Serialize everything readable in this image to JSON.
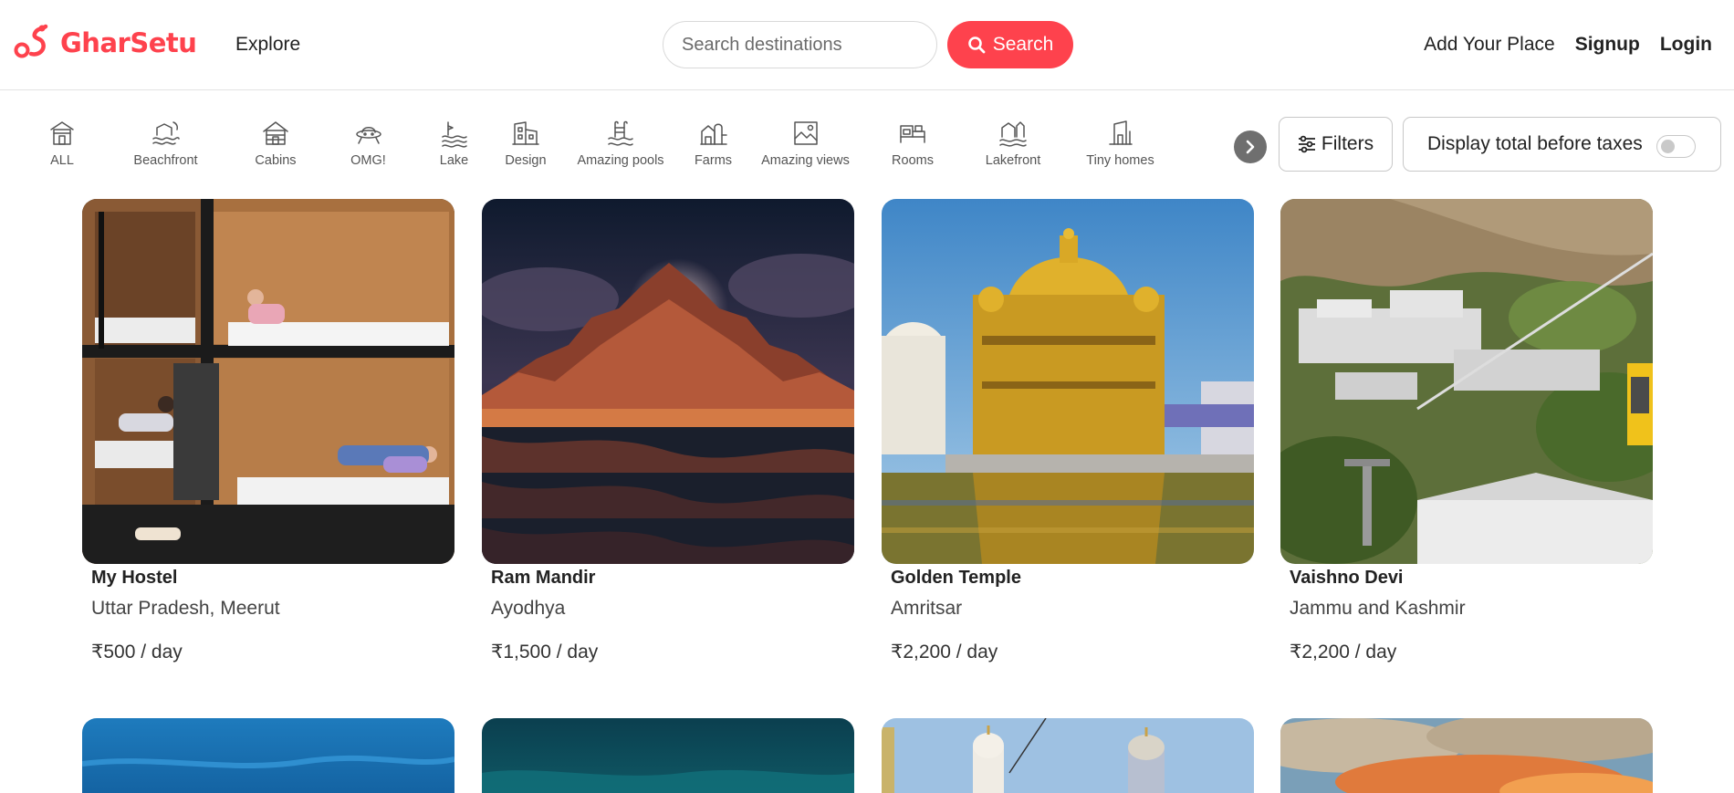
{
  "header": {
    "brand": "GharSetu",
    "explore": "Explore",
    "search_placeholder": "Search destinations",
    "search_button": "Search",
    "add_place": "Add Your Place",
    "signup": "Signup",
    "login": "Login"
  },
  "colors": {
    "accent": "#fe424d",
    "text": "#222222",
    "muted": "#555555"
  },
  "categories": [
    {
      "label": "ALL",
      "icon": "house-icon"
    },
    {
      "label": "Beachfront",
      "icon": "beachfront-icon"
    },
    {
      "label": "Cabins",
      "icon": "cabin-icon"
    },
    {
      "label": "OMG!",
      "icon": "ufo-icon"
    },
    {
      "label": "Lake",
      "icon": "lake-icon"
    },
    {
      "label": "Design",
      "icon": "design-building-icon"
    },
    {
      "label": "Amazing pools",
      "icon": "pool-icon"
    },
    {
      "label": "Farms",
      "icon": "farm-icon"
    },
    {
      "label": "Amazing views",
      "icon": "view-frame-icon"
    },
    {
      "label": "Rooms",
      "icon": "bed-room-icon"
    },
    {
      "label": "Lakefront",
      "icon": "lakefront-icon"
    },
    {
      "label": "Tiny homes",
      "icon": "tiny-home-icon"
    }
  ],
  "filters": {
    "filters_label": "Filters",
    "taxes_label": "Display total before taxes",
    "taxes_toggle_on": false
  },
  "listings": [
    {
      "title": "My Hostel",
      "location": "Uttar Pradesh, Meerut",
      "price": "₹500 / day"
    },
    {
      "title": "Ram Mandir",
      "location": "Ayodhya",
      "price": "₹1,500 / day"
    },
    {
      "title": "Golden Temple",
      "location": "Amritsar",
      "price": "₹2,200 / day"
    },
    {
      "title": "Vaishno Devi",
      "location": "Jammu and Kashmir",
      "price": "₹2,200 / day"
    }
  ]
}
